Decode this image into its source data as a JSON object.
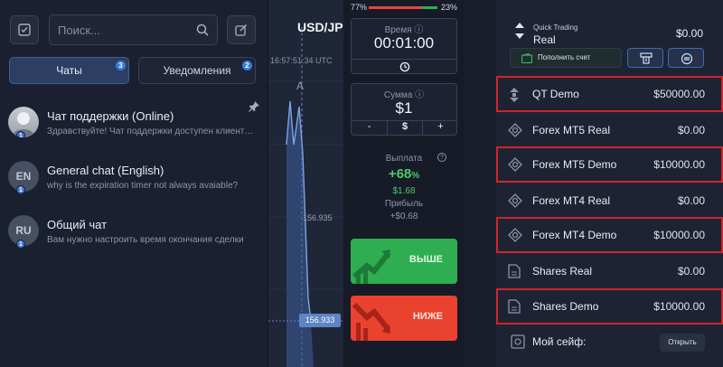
{
  "left_panel": {
    "search_placeholder": "Поиск...",
    "tabs": [
      {
        "label": "Чаты",
        "count": "3"
      },
      {
        "label": "Уведомления",
        "count": "2"
      }
    ],
    "chats": [
      {
        "title": "Чат поддержки (Online)",
        "preview": "Здравствуйте! Чат поддержки доступен клиентам",
        "badge": "1",
        "avatar": ""
      },
      {
        "title": "General chat (English)",
        "preview": "why is the expiration timer not always avaiable?",
        "badge": "1",
        "avatar": "EN"
      },
      {
        "title": "Общий чат",
        "preview": "Вам нужно настроить время окончания сделки",
        "badge": "1",
        "avatar": "RU"
      }
    ]
  },
  "chart": {
    "pair": "USD/JPY",
    "time": "16:57:51:34 UTC",
    "marker": "A",
    "price_label": "156.935",
    "current_price": "156.933"
  },
  "trade": {
    "sentiment": {
      "left": "77%",
      "right": "23%",
      "left_fraction": 0.77
    },
    "time_label": "Время",
    "time_value": "00:01:00",
    "amount_label": "Сумма",
    "amount_value": "$1",
    "minus": "-",
    "currency": "$",
    "plus": "+",
    "payout_label": "Выплата",
    "payout_percent": "+68",
    "payout_percent_sign": "%",
    "payout_amount": "$1.68",
    "profit_label": "Прибыль",
    "profit_value": "+$0.68",
    "buy_label": "ВЫШЕ",
    "sell_label": "НИЖЕ"
  },
  "accounts": {
    "quick_trading": {
      "title": "Quick Trading",
      "mode": "Real",
      "balance": "$0.00"
    },
    "topup_label": "Пополнить счет",
    "list": [
      {
        "name": "QT Demo",
        "amount": "$50000.00",
        "highlight": true
      },
      {
        "name": "Forex MT5 Real",
        "amount": "$0.00",
        "highlight": false
      },
      {
        "name": "Forex MT5 Demo",
        "amount": "$10000.00",
        "highlight": true
      },
      {
        "name": "Forex MT4 Real",
        "amount": "$0.00",
        "highlight": false
      },
      {
        "name": "Forex MT4 Demo",
        "amount": "$10000.00",
        "highlight": true
      },
      {
        "name": "Shares Real",
        "amount": "$0.00",
        "highlight": false
      },
      {
        "name": "Shares Demo",
        "amount": "$10000.00",
        "highlight": true
      }
    ],
    "safe_label": "Мой сейф:",
    "open_label": "Открыть"
  },
  "colors": {
    "green": "#2fae51",
    "red": "#e9432f",
    "highlight_border": "#d0242c",
    "accent_blue": "#3a7ad8"
  }
}
